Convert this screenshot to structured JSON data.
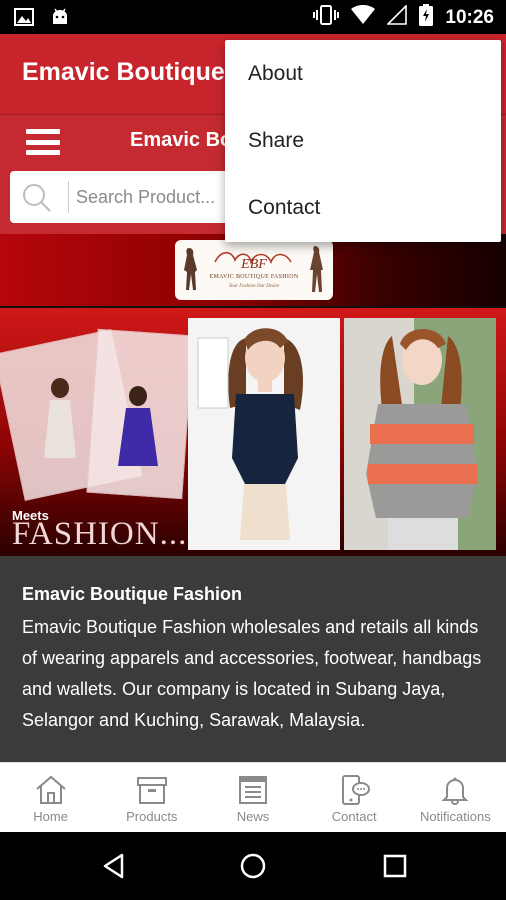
{
  "status_bar": {
    "time": "10:26",
    "icons": [
      "image-icon",
      "android-icon",
      "vibrate-icon",
      "wifi-icon",
      "signal-icon",
      "battery-charging-icon"
    ]
  },
  "app_bar": {
    "title": "Emavic Boutique Fashion"
  },
  "header": {
    "title": "Emavic Boutique Fashion"
  },
  "search": {
    "placeholder": "Search Product..."
  },
  "logo": {
    "brand": "EMAVIC BOUTIQUE FASHION",
    "tagline": "Your Fashion Our Desire"
  },
  "hero": {
    "meets": "Meets",
    "fashion": "FASHION..."
  },
  "description": {
    "title": "Emavic Boutique Fashion",
    "body": "Emavic Boutique Fashion wholesales and retails all kinds of wearing apparels and accessories, footwear, handbags and wallets. Our company is located in Subang Jaya, Selangor and Kuching, Sarawak, Malaysia."
  },
  "bottom_nav": {
    "items": [
      {
        "label": "Home",
        "icon": "home-icon"
      },
      {
        "label": "Products",
        "icon": "box-icon"
      },
      {
        "label": "News",
        "icon": "news-icon"
      },
      {
        "label": "Contact",
        "icon": "contact-phone-icon"
      },
      {
        "label": "Notifications",
        "icon": "bell-icon"
      }
    ]
  },
  "overflow_menu": {
    "items": [
      {
        "label": "About"
      },
      {
        "label": "Share"
      },
      {
        "label": "Contact"
      }
    ]
  },
  "colors": {
    "primary": "#c8242c",
    "header": "#c42a30",
    "description_bg": "#3b3b3b",
    "nav_label": "#8a8a8a"
  }
}
